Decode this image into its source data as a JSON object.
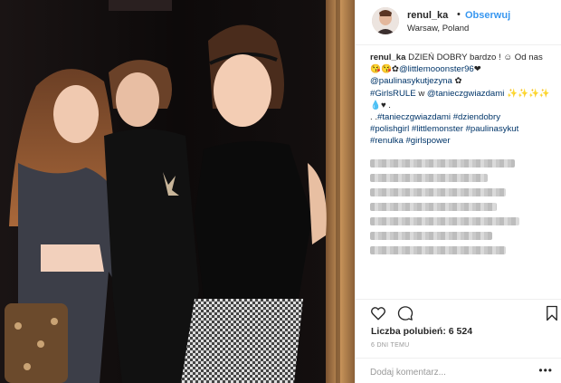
{
  "post": {
    "photo_icon": "instagram-photo",
    "header": {
      "username": "renul_ka",
      "separator": "•",
      "follow_label": "Obserwuj",
      "location": "Warsaw, Poland"
    },
    "caption": {
      "user": "renul_ka",
      "line1_rest": " DZIEŃ DOBRY bardzo ! ☺ Od nas",
      "line2_prefix": "😘😘✿",
      "line2_mention": "@littlemooonster96",
      "line2_suffix": "❤",
      "line3_mention": "@paulinasykutjezyna",
      "line3_suffix": " ✿",
      "line4_hashtag": "#GirlsRULE",
      "line4_mid": " w ",
      "line4_mention": "@tanieczgwiazdami",
      "line4_suffix": " ✨✨✨✨",
      "line5": "💧♥ .",
      "line6_prefix": ". .",
      "line6_tags": "#tanieczgwiazdami #dziendobry",
      "line7_tags": "#polishgirl #littlemonster #paulinasykut",
      "line8_tags": "#renulka #girlspower"
    },
    "icons": {
      "like": "heart-icon",
      "comment": "comment-icon",
      "save": "bookmark-icon"
    },
    "likes": {
      "label": "Liczba polubień:",
      "count": "6 524"
    },
    "time_ago": "6 DNI TEMU",
    "comment_input": {
      "placeholder": "Dodaj komentarz..."
    },
    "more_label": "•••"
  }
}
